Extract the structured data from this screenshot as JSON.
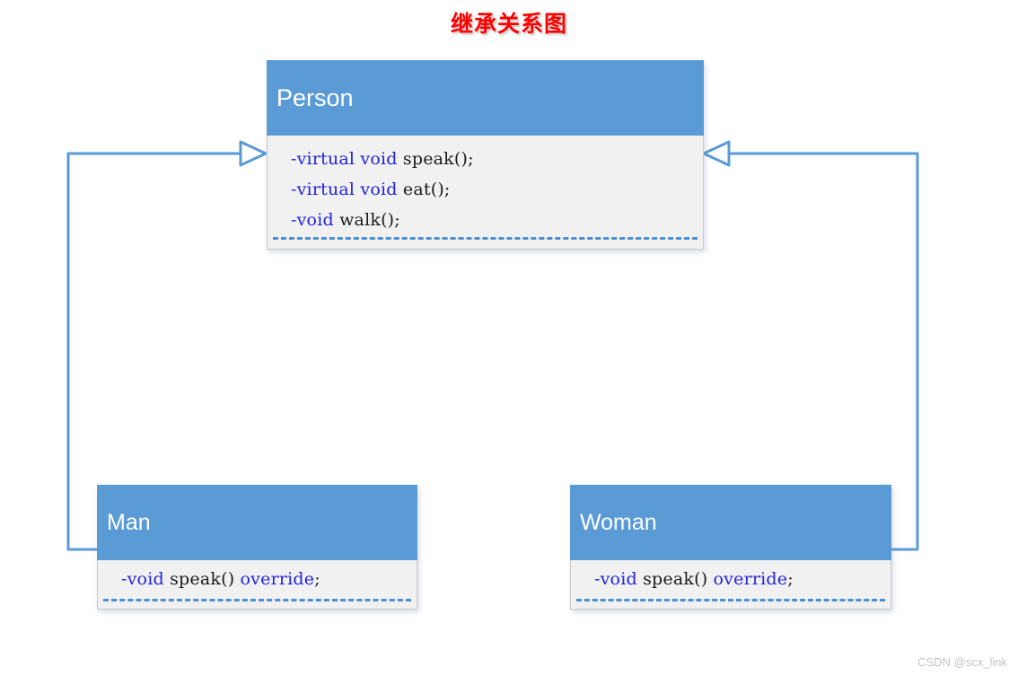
{
  "title": "继承关系图",
  "watermark": "CSDN @scx_link",
  "colors": {
    "header_blue": "#5b9bd5",
    "body_gray": "#f1f1f1",
    "connector_blue": "#5b9bd5",
    "keyword_blue": "#2222dd",
    "title_red": "#ff0000",
    "dash_blue": "#4d90d4"
  },
  "classes": {
    "person": {
      "name": "Person",
      "members": [
        {
          "kw1": "-virtual void",
          "rest": " speak();"
        },
        {
          "kw1": "-virtual void",
          "rest": " eat();"
        },
        {
          "kw1": "-void",
          "rest": " walk();"
        }
      ]
    },
    "man": {
      "name": "Man",
      "members": [
        {
          "kw1": "-void",
          "mid": " speak() ",
          "kw2": "override",
          "rest": ";"
        }
      ]
    },
    "woman": {
      "name": "Woman",
      "members": [
        {
          "kw1": "-void",
          "mid": " speak() ",
          "kw2": "override",
          "rest": ";"
        }
      ]
    }
  },
  "relations": [
    {
      "from": "Man",
      "to": "Person",
      "type": "generalization",
      "arrow": "hollow-triangle"
    },
    {
      "from": "Woman",
      "to": "Person",
      "type": "generalization",
      "arrow": "hollow-triangle"
    }
  ]
}
